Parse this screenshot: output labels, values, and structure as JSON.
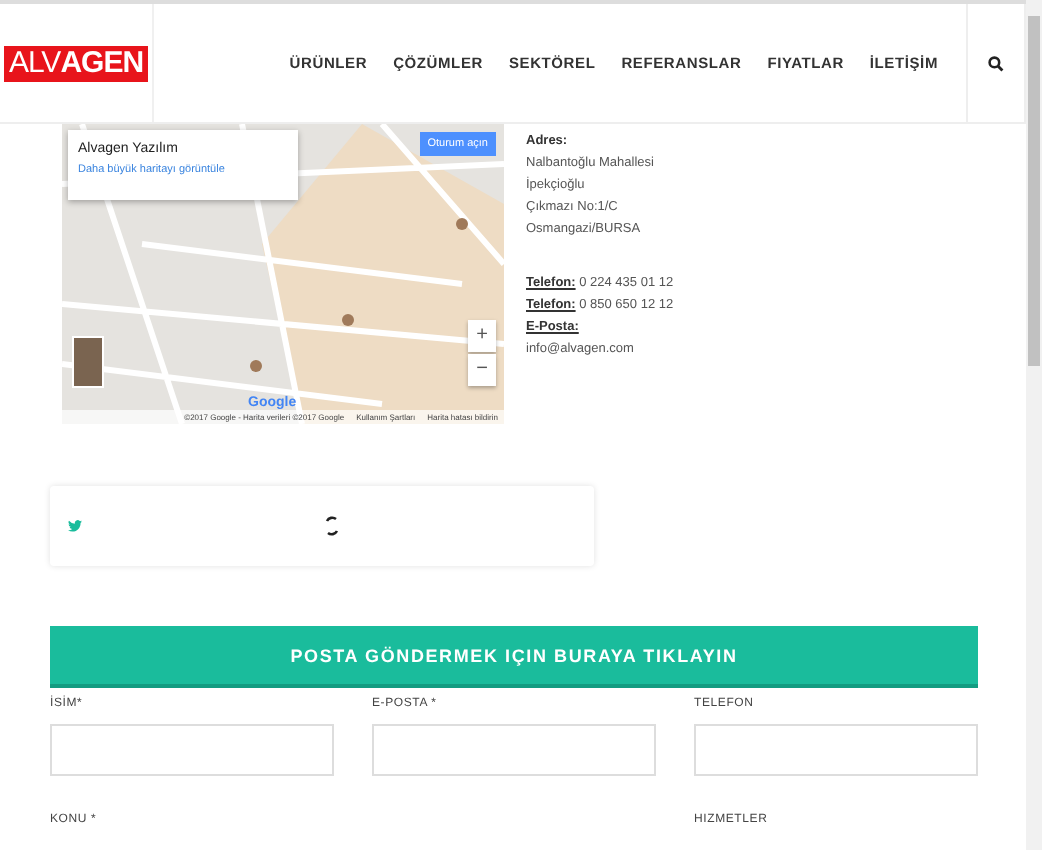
{
  "header": {
    "logo": {
      "light": "ALV",
      "bold": "AGEN"
    },
    "nav": [
      {
        "label": "ÜRÜNLER",
        "selected": false
      },
      {
        "label": "ÇÖZÜMLER",
        "selected": false
      },
      {
        "label": "SEKTÖREL",
        "selected": false
      },
      {
        "label": "REFERANSLAR",
        "selected": false
      },
      {
        "label": "FIYATLAR",
        "selected": false
      },
      {
        "label": "İLETİŞİM",
        "selected": false
      }
    ]
  },
  "map": {
    "place_title": "Alvagen Yazılım",
    "place_link": "Daha büyük haritayı görüntüle",
    "sign_in": "Oturum açın",
    "zoom_in": "+",
    "zoom_out": "−",
    "google": "Google",
    "attribution": "©2017 Google - Harita verileri ©2017 Google",
    "terms": "Kullanım Şartları",
    "report": "Harita hatası bildirin"
  },
  "address": {
    "heading": "Adres:",
    "lines": [
      "Nalbantoğlu Mahallesi",
      "İpekçioğlu",
      "Çıkmazı No:1/C",
      "Osmangazi/BURSA"
    ],
    "contacts": [
      {
        "label": "Telefon:",
        "value": " 0 224 435 01 12"
      },
      {
        "label": "Telefon:",
        "value": " 0 850 650 12 12"
      },
      {
        "label": "E-Posta:"
      }
    ],
    "email": "info@alvagen.com"
  },
  "form": {
    "button": "POSTA GÖNDERMEK IÇIN BURAYA TIKLAYIN",
    "fields": [
      {
        "label": "İSİM*"
      },
      {
        "label": "E-POSTA *"
      },
      {
        "label": "TELEFON"
      }
    ],
    "subject": {
      "label": "KONU *"
    },
    "services": {
      "label": "HIZMETLER"
    }
  }
}
